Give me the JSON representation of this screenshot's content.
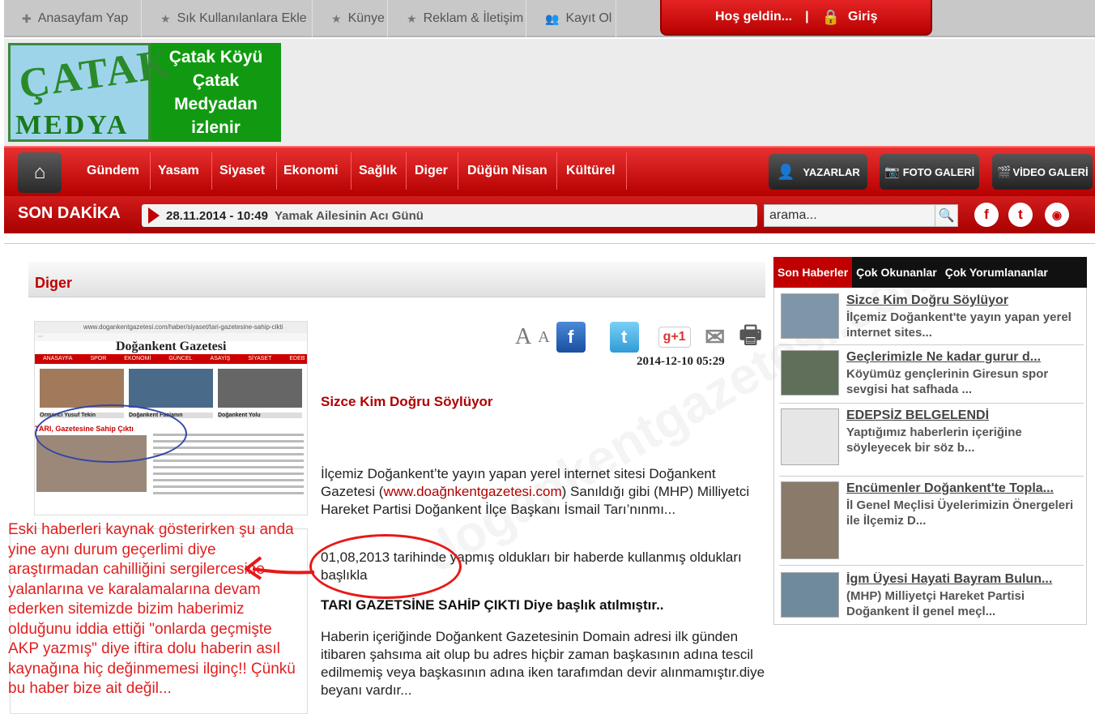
{
  "topbar": {
    "items": [
      {
        "label": "Anasayfam Yap",
        "icon": "plus-icon"
      },
      {
        "label": "Sık Kullanılanlara Ekle",
        "icon": "star-icon"
      },
      {
        "label": "Künye",
        "icon": "star-icon"
      },
      {
        "label": "Reklam & İletişim",
        "icon": "star-icon"
      },
      {
        "label": "Kayıt Ol",
        "icon": "users-icon"
      }
    ],
    "welcome": "Hoş geldin...",
    "separator": "|",
    "login": "Giriş"
  },
  "logo": {
    "top": "ÇATAK",
    "bottom": "MEDYA",
    "slogan_1": "Çatak Köyü",
    "slogan_2": "Çatak",
    "slogan_3": "Medyadan",
    "slogan_4": "izlenir"
  },
  "nav": {
    "items": [
      "Gündem",
      "Yasam",
      "Siyaset",
      "Ekonomi",
      "Sağlık",
      "Diger",
      "Düğün Nisan",
      "Kültürel"
    ],
    "buttons": {
      "writers": "YAZARLAR",
      "photo": "FOTO GALERİ",
      "video": "VİDEO GALERİ"
    }
  },
  "breaking": {
    "label": "SON DAKİKA",
    "date": "28.11.2014 - 10:49",
    "headline": "Yamak Ailesinin Acı Günü",
    "search_value": "arama..."
  },
  "category": {
    "title": "Diger"
  },
  "screenshot": {
    "url": "www.dogankentgazetesi.com/haber/siyaset/tari-gazetesine-sahip-cikti",
    "site_title": "Doğankent Gazetesi",
    "menu": [
      "ANASAYFA",
      "SPOR",
      "EKONOMİ",
      "GÜNCEL",
      "ASAYİŞ",
      "SİYASET",
      "EDEB"
    ],
    "captions": [
      "Ormancı Yusuf Tekin",
      "Doğankent Facianın",
      "Doğankent Yolu"
    ],
    "headline": "TARI, Gazetesine Sahip Çıktı"
  },
  "note": "Eski haberleri kaynak gösterirken şu anda yine aynı durum geçerlimi diye araştırmadan cahilliğini sergilercesine yalanlarına ve karalamalarına devam ederken sitemizde bizim haberimiz olduğunu iddia ettiği \"onlarda geçmişte AKP yazmış\" diye iftira dolu haberin asıl kaynağına hiç değinmemesi ilginç!! Çünkü bu haber bize ait değil...",
  "article": {
    "date": "2014-12-10 05:29",
    "title": "Sizce Kim Doğru Söylüyor",
    "p1": "İlçemiz Doğankent’te yayın yapan yerel internet sitesi Doğankent Gazetesi (",
    "p1_link": "www.doağnkentgazetesi.com",
    "p1_rest": ") Sanıldığı gibi (MHP) Milliyetci Hareket Partisi Doğankent İlçe Başkanı İsmail Tarı’nınmı...",
    "p2": "01,08,2013 tarihinde yapmış oldukları bir haberde kullanmış oldukları başlıkla",
    "p3": "TARI GAZETSİNE SAHİP ÇIKTI Diye başlık atılmıştır..",
    "p4": "Haberin içeriğinde Doğankent Gazetesinin Domain adresi ilk günden itibaren şahsıma ait olup bu adres hiçbir zaman başkasının adına tescil edilmemiş veya başkasının adına iken tarafımdan devir alınmamıştır.diye beyanı vardır..."
  },
  "tools": {
    "font_big": "A",
    "font_small": "A",
    "facebook": "f",
    "twitter": "t",
    "gplus": "g+1"
  },
  "sidebar": {
    "tabs": [
      "Son Haberler",
      "Çok Okunanlar",
      "Çok Yorumlananlar"
    ],
    "news": [
      {
        "title": "Sizce Kim Doğru Söylüyor",
        "desc": "İlçemiz Doğankent'te yayın yapan yerel internet sites..."
      },
      {
        "title": "Geçlerimizle Ne kadar gurur d...",
        "desc": "Köyümüz gençlerinin Giresun spor sevgisi hat safhada ..."
      },
      {
        "title": "EDEPSİZ BELGELENDİ",
        "desc": "Yaptığımız haberlerin içeriğine söyleyecek bir söz b..."
      },
      {
        "title": "Encümenler Doğankent'te Topla...",
        "desc": "İl Genel Meçlisi Üyelerimizin Önergeleri ile İlçemiz D..."
      },
      {
        "title": "İgm Üyesi Hayati Bayram Bulun...",
        "desc": "(MHP) Milliyetçi Hareket Partisi Doğankent İl genel meçl..."
      }
    ]
  },
  "colors": {
    "brand_red": "#c00000",
    "logo_green": "#119a11",
    "note_red": "#e02020"
  }
}
